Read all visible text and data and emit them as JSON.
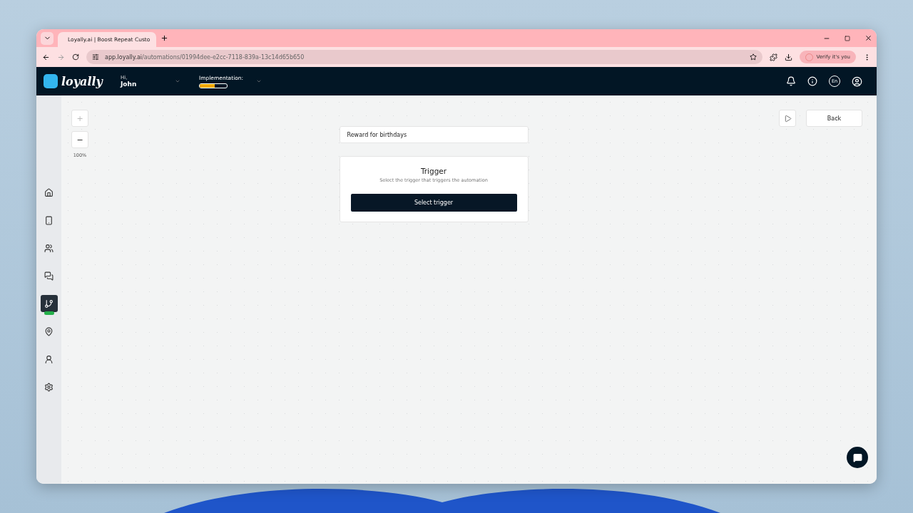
{
  "browser": {
    "tab_title": "Loyally.ai | Boost Repeat Custo",
    "url_host": "app.loyally.ai",
    "url_path": "/automations/01994dee-e2cc-7118-839a-13c14d65b650",
    "profile_button": "Verify it's you"
  },
  "header": {
    "logo": "loyally",
    "greeting": "Hi,",
    "user": "John",
    "implementation_label": "Implementation:",
    "implementation": {
      "level": 0.55
    },
    "language": "En"
  },
  "sidebar": {
    "items": [
      {
        "kind": "home",
        "selected": false
      },
      {
        "kind": "device",
        "selected": false
      },
      {
        "kind": "customers",
        "selected": false
      },
      {
        "kind": "messages",
        "selected": false
      },
      {
        "kind": "automations",
        "selected": true,
        "badge": true
      },
      {
        "kind": "locations",
        "selected": false
      },
      {
        "kind": "profile",
        "selected": false
      },
      {
        "kind": "settings",
        "selected": false
      }
    ]
  },
  "zoom": {
    "plus": "+",
    "minus": "−",
    "value": "100%"
  },
  "automation_name": {
    "value": "Reward for birthdays"
  },
  "trigger_card": {
    "title": "Trigger",
    "subtitle": "Select the trigger that triggers the automation",
    "button": "Select trigger"
  },
  "back_button": "Back"
}
